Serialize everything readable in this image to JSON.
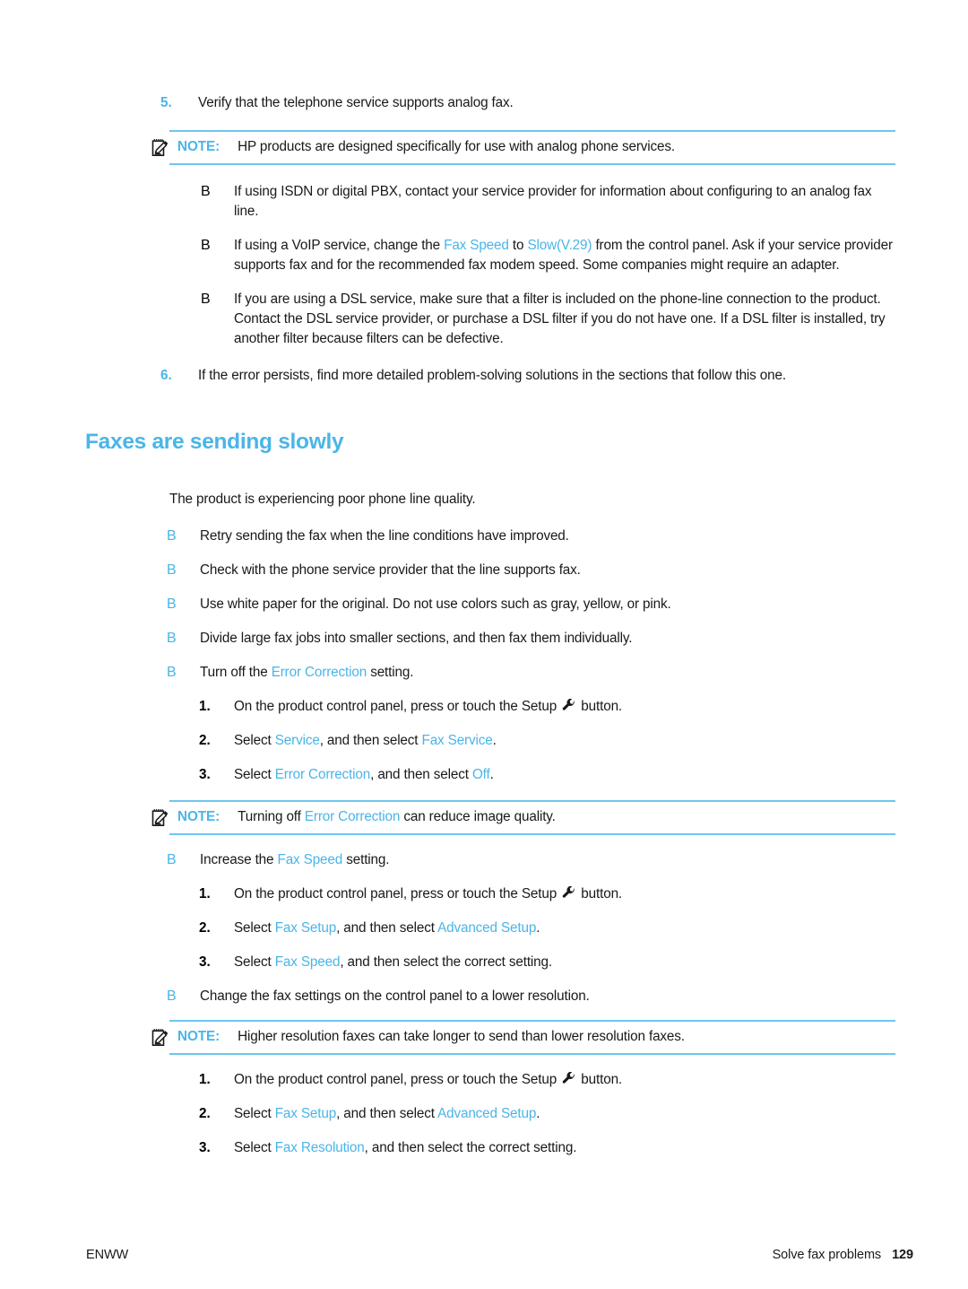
{
  "document": {
    "heading": "Faxes are sending slowly",
    "intro_paragraph": "The product is experiencing poor phone line quality."
  },
  "steps_top": {
    "step5_number": "5.",
    "step5_text": "Verify that the telephone service supports analog fax.",
    "step6_number": "6.",
    "step6_text": "If the error persists, find more detailed problem-solving solutions in the sections that follow this one."
  },
  "notes": {
    "label": "NOTE:",
    "icon": "note-pencil-icon",
    "note1_text": "HP products are designed specifically for use with analog phone services.",
    "note2_prefix": "Turning off ",
    "note2_link": "Error Correction",
    "note2_suffix": " can reduce image quality.",
    "note3_text": "Higher resolution faxes can take longer to send than lower resolution faxes."
  },
  "nested_bullets": {
    "marker": "B",
    "item1": "If using ISDN or digital PBX, contact your service provider for information about configuring to an analog fax line.",
    "item2_part1": "If using a VoIP service, change the ",
    "item2_link1": "Fax Speed",
    "item2_part2": " to ",
    "item2_link2": "Slow(V.29)",
    "item2_part3": " from the control panel. Ask if your service provider supports fax and for the recommended fax modem speed. Some companies might require an adapter.",
    "item3": "If you are using a DSL service, make sure that a filter is included on the phone-line connection to the product. Contact the DSL service provider, or purchase a DSL filter if you do not have one. If a DSL filter is installed, try another filter because filters can be defective."
  },
  "solution_bullets": {
    "marker": "B",
    "b1": "Retry sending the fax when the line conditions have improved.",
    "b2": "Check with the phone service provider that the line supports fax.",
    "b3": "Use white paper for the original. Do not use colors such as gray, yellow, or pink.",
    "b4": "Divide large fax jobs into smaller sections, and then fax them individually.",
    "b5_prefix": "Turn off the ",
    "b5_link": "Error Correction",
    "b5_suffix": " setting.",
    "b6_prefix": "Increase the ",
    "b6_link": "Fax Speed",
    "b6_suffix": " setting.",
    "b7": "Change the fax settings on the control panel to a lower resolution."
  },
  "substeps_error_correction": {
    "n1": "1.",
    "s1_prefix": "On the product control panel, press or touch the Setup ",
    "s1_icon": "wrench-icon",
    "s1_suffix": " button.",
    "n2": "2.",
    "s2_prefix": "Select ",
    "s2_link1": "Service",
    "s2_mid": ", and then select ",
    "s2_link2": "Fax Service",
    "s2_suffix": ".",
    "n3": "3.",
    "s3_prefix": "Select ",
    "s3_link1": "Error Correction",
    "s3_mid": ", and then select ",
    "s3_link2": "Off",
    "s3_suffix": "."
  },
  "substeps_fax_speed": {
    "n1": "1.",
    "s1_prefix": "On the product control panel, press or touch the Setup ",
    "s1_icon": "wrench-icon",
    "s1_suffix": " button.",
    "n2": "2.",
    "s2_prefix": "Select ",
    "s2_link1": "Fax Setup",
    "s2_mid": ", and then select ",
    "s2_link2": "Advanced Setup",
    "s2_suffix": ".",
    "n3": "3.",
    "s3_prefix": "Select ",
    "s3_link1": "Fax Speed",
    "s3_suffix": ", and then select the correct setting."
  },
  "substeps_fax_resolution": {
    "n1": "1.",
    "s1_prefix": "On the product control panel, press or touch the Setup ",
    "s1_icon": "wrench-icon",
    "s1_suffix": " button.",
    "n2": "2.",
    "s2_prefix": "Select ",
    "s2_link1": "Fax Setup",
    "s2_mid": ", and then select ",
    "s2_link2": "Advanced Setup",
    "s2_suffix": ".",
    "n3": "3.",
    "s3_prefix": "Select ",
    "s3_link1": "Fax Resolution",
    "s3_suffix": ", and then select the correct setting."
  },
  "footer": {
    "left": "ENWW",
    "chapter": "Solve fax problems",
    "page_number": "129"
  },
  "colors": {
    "accent_blue": "#4ab5e8",
    "rule_blue": "#6ec6ee",
    "text_black": "#18191a"
  }
}
